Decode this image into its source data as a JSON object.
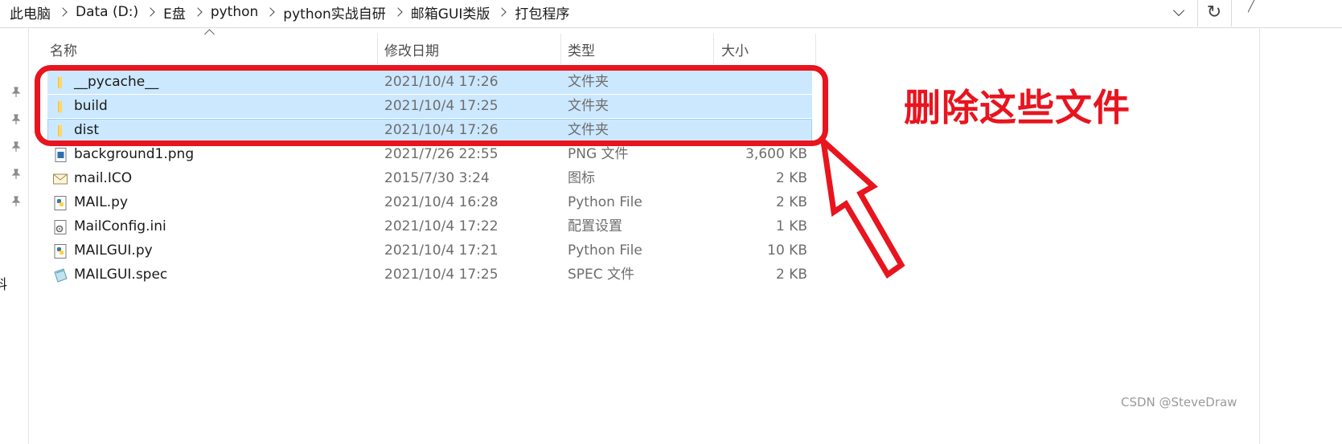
{
  "breadcrumb": [
    "此电脑",
    "Data (D:)",
    "E盘",
    "python",
    "python实战自研",
    "邮箱GUI类版",
    "打包程序"
  ],
  "toolbar": {
    "refresh_glyph": "↻",
    "search_edge_glyph": "╱"
  },
  "nav": {
    "partial_label": "料"
  },
  "columns": {
    "name": "名称",
    "date": "修改日期",
    "type": "类型",
    "size": "大小"
  },
  "files": [
    {
      "name": "__pycache__",
      "date": "2021/10/4 17:26",
      "type": "文件夹",
      "size": "",
      "icon": "folder-icon",
      "selected": true
    },
    {
      "name": "build",
      "date": "2021/10/4 17:25",
      "type": "文件夹",
      "size": "",
      "icon": "folder-icon",
      "selected": true
    },
    {
      "name": "dist",
      "date": "2021/10/4 17:26",
      "type": "文件夹",
      "size": "",
      "icon": "folder-icon",
      "selected": true
    },
    {
      "name": "background1.png",
      "date": "2021/7/26 22:55",
      "type": "PNG 文件",
      "size": "3,600 KB",
      "icon": "image-file-icon",
      "selected": false
    },
    {
      "name": "mail.ICO",
      "date": "2015/7/30 3:24",
      "type": "图标",
      "size": "2 KB",
      "icon": "envelope-icon",
      "selected": false
    },
    {
      "name": "MAIL.py",
      "date": "2021/10/4 16:28",
      "type": "Python File",
      "size": "2 KB",
      "icon": "python-file-icon",
      "selected": false
    },
    {
      "name": "MailConfig.ini",
      "date": "2021/10/4 17:22",
      "type": "配置设置",
      "size": "1 KB",
      "icon": "config-file-icon",
      "selected": false
    },
    {
      "name": "MAILGUI.py",
      "date": "2021/10/4 17:21",
      "type": "Python File",
      "size": "10 KB",
      "icon": "python-file-icon",
      "selected": false
    },
    {
      "name": "MAILGUI.spec",
      "date": "2021/10/4 17:25",
      "type": "SPEC 文件",
      "size": "2 KB",
      "icon": "spec-file-icon",
      "selected": false
    }
  ],
  "annotation": {
    "text": "删除这些文件",
    "color": "#e8141e"
  },
  "watermark": "CSDN @SteveDraw",
  "colors": {
    "selection": "#cce8ff",
    "selection_border": "#99d1ff",
    "annotation_red": "#e8141e"
  }
}
